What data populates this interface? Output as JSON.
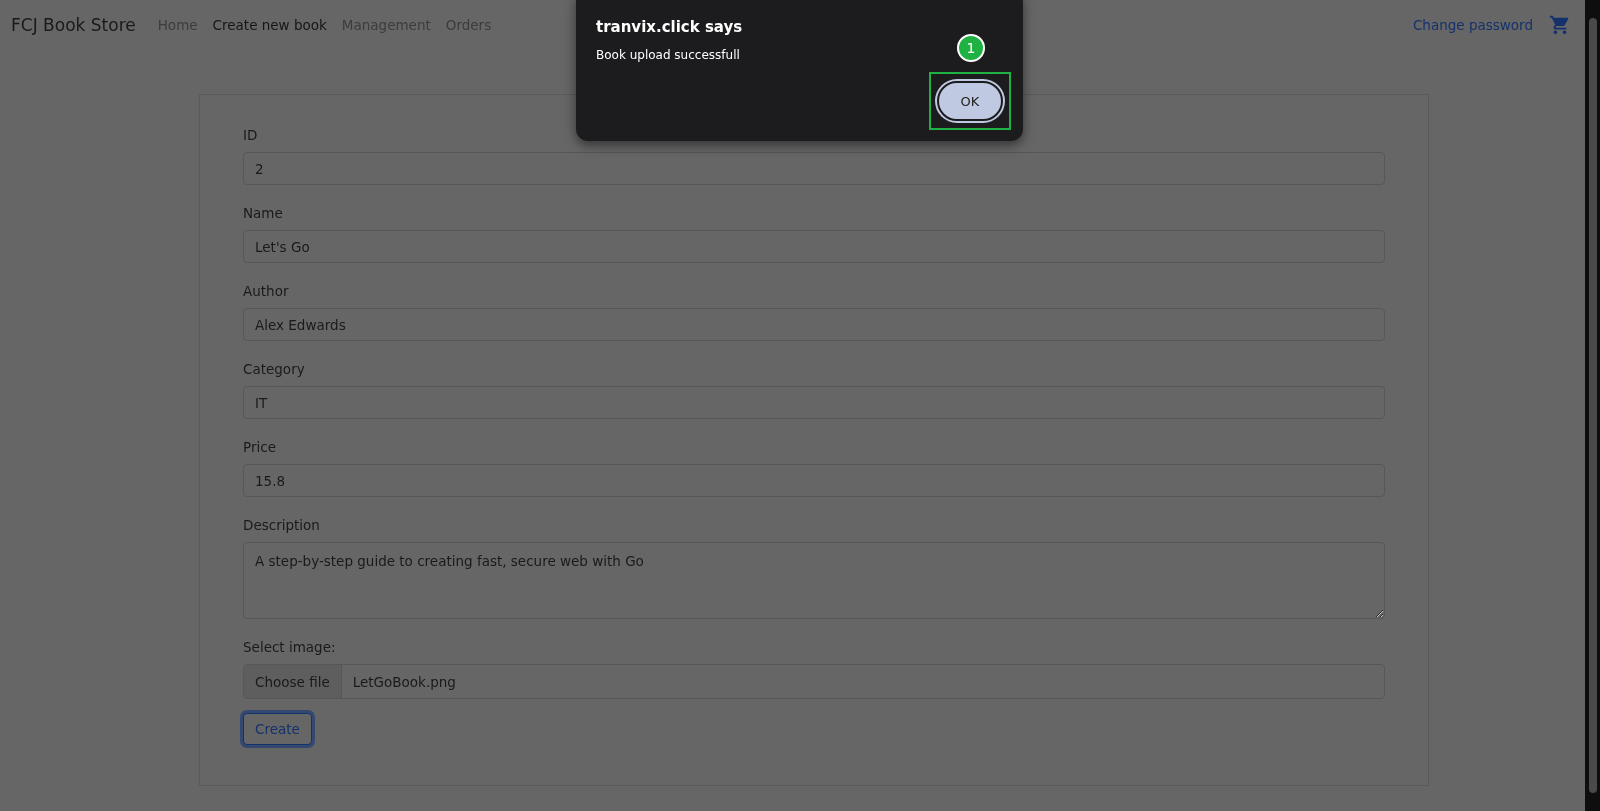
{
  "navbar": {
    "brand": "FCJ Book Store",
    "links": [
      {
        "label": "Home",
        "selected": false
      },
      {
        "label": "Create new book",
        "selected": true
      },
      {
        "label": "Management",
        "selected": false
      },
      {
        "label": "Orders",
        "selected": false
      }
    ],
    "account_link": "Change password"
  },
  "form": {
    "fields": [
      {
        "label": "ID",
        "value": "2",
        "kind": "text"
      },
      {
        "label": "Name",
        "value": "Let's Go",
        "kind": "text"
      },
      {
        "label": "Author",
        "value": "Alex Edwards",
        "kind": "text"
      },
      {
        "label": "Category",
        "value": "IT",
        "kind": "text"
      },
      {
        "label": "Price",
        "value": "15.8",
        "kind": "text"
      },
      {
        "label": "Description",
        "value": "A step-by-step guide to creating fast, secure web with Go",
        "kind": "textarea"
      }
    ],
    "file": {
      "label": "Select image:",
      "button": "Choose file",
      "filename": "LetGoBook.png"
    },
    "submit": "Create"
  },
  "dialog": {
    "title": "tranvix.click says",
    "message": "Book upload successfull",
    "ok": "OK",
    "step_badge": "1"
  }
}
